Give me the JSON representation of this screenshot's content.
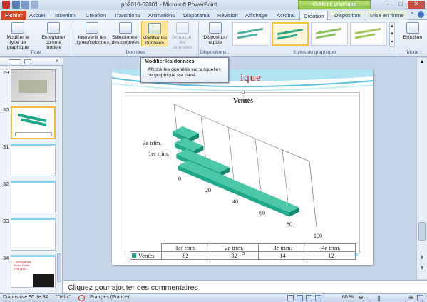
{
  "window": {
    "title": "pp2010-02001 - Microsoft PowerPoint",
    "context_tab": "Outils de graphique"
  },
  "tabs": [
    "Fichier",
    "Accueil",
    "Insertion",
    "Création",
    "Transitions",
    "Animations",
    "Diaporama",
    "Révision",
    "Affichage",
    "Acrobat",
    "Création",
    "Disposition",
    "Mise en forme"
  ],
  "ribbon": {
    "buttons": [
      "Modifier le type de graphique",
      "Enregistrer comme modèle",
      "Intervertir les lignes/colonnes",
      "Sélectionner des données",
      "Modifier les données",
      "Actualiser les données",
      "Disposition rapide",
      "Brouillon"
    ],
    "groups": [
      "Type",
      "Données",
      "Dispositions...",
      "Styles du graphique",
      "Mode"
    ]
  },
  "tooltip": {
    "title": "Modifier les données",
    "body": "Affiche les données sur lesquelles ce graphique est basé."
  },
  "slides_panel": {
    "numbers": [
      "29",
      "30",
      "31",
      "32",
      "33",
      "34"
    ],
    "selected": "30",
    "thumb34_lines": [
      "L'informatique",
      "Grand  Public",
      "c'est quoi..."
    ]
  },
  "slide": {
    "title_fragment": "ique",
    "number": "30",
    "colors": {
      "bar": "#1fa98a",
      "title": "#c0272d"
    }
  },
  "chart_data": {
    "type": "bar",
    "title": "Ventes",
    "categories": [
      "1er trim.",
      "2e trim.",
      "3e trim.",
      "4e trim."
    ],
    "series": [
      {
        "name": "Ventes",
        "values": [
          82,
          32,
          14,
          12
        ]
      }
    ],
    "axis_ticks": [
      "0",
      "20",
      "40",
      "60",
      "80",
      "100"
    ],
    "visible_row_labels": [
      "3e trim.",
      "1er trim."
    ],
    "xlim": [
      0,
      100
    ],
    "table_values": [
      "82",
      "32",
      "14",
      "12"
    ]
  },
  "notes_placeholder": "Cliquez pour ajouter des commentaires",
  "status": {
    "slide_info": "Diapositive 30 de 34",
    "theme": "\"Débit\"",
    "language": "Français (France)",
    "zoom": "65 %"
  }
}
